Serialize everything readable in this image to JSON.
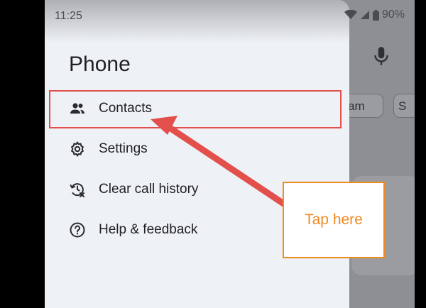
{
  "status_bar": {
    "time": "11:25",
    "battery": "90%"
  },
  "drawer": {
    "title": "Phone",
    "items": [
      {
        "label": "Contacts",
        "icon": "people-icon"
      },
      {
        "label": "Settings",
        "icon": "gear-icon"
      },
      {
        "label": "Clear call history",
        "icon": "history-clear-icon"
      },
      {
        "label": "Help & feedback",
        "icon": "help-icon"
      }
    ]
  },
  "background": {
    "chip_1": "am",
    "chip_2": "S"
  },
  "annotation": {
    "callout_text": "Tap here",
    "highlight_color": "#e3504c",
    "callout_color": "#f08a24"
  }
}
